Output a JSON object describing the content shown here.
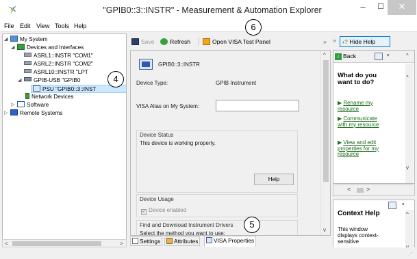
{
  "window": {
    "title": "\"GPIB0::3::INSTR\" - Measurement & Automation Explorer",
    "minimize": "–",
    "maximize": "☐",
    "close": "✕"
  },
  "menu": [
    "File",
    "Edit",
    "View",
    "Tools",
    "Help"
  ],
  "tree": {
    "items": [
      {
        "label": "My System"
      },
      {
        "label": "Devices and Interfaces"
      },
      {
        "label": "ASRL1::INSTR \"COM1\""
      },
      {
        "label": "ASRL2::INSTR \"COM2\""
      },
      {
        "label": "ASRL10::INSTR \"LPT"
      },
      {
        "label": "GPIB-USB  \"GPIB0"
      },
      {
        "label": "PSU    \"GPIB0::3::INST"
      },
      {
        "label": "Network Devices"
      },
      {
        "label": "Software"
      },
      {
        "label": "Remote Systems"
      }
    ]
  },
  "toolbar": {
    "save": "Save",
    "refresh": "Refresh",
    "open_visa": "Open VISA Test Panel",
    "overflow": "»"
  },
  "device": {
    "name": "GPIB0::3::INSTR",
    "type_label": "Device Type:",
    "type_value": "GPIB Instrument",
    "alias_label": "VISA Alias on My System:",
    "alias_value": "",
    "status_title": "Device Status",
    "status_text": "This device is working properly.",
    "help_button": "Help",
    "usage_title": "Device Usage",
    "enabled_label": "Device enabled",
    "drivers_title": "Find and Download Instrument Drivers",
    "drivers_text": "Select the method you want to use:"
  },
  "tabs": [
    {
      "label": "Settings"
    },
    {
      "label": "Attributes"
    },
    {
      "label": "VISA Properties"
    }
  ],
  "help": {
    "hide_button": "Hide Help",
    "overflow": "»",
    "back": "Back",
    "question": "What do you want to do?",
    "links": [
      "Rename my resource",
      "Communicate with my resource",
      "View and edit properties for my resource"
    ],
    "context_title": "Context Help",
    "context_text": "This window displays context-sensitive"
  },
  "callouts": [
    "4",
    "5",
    "6"
  ]
}
